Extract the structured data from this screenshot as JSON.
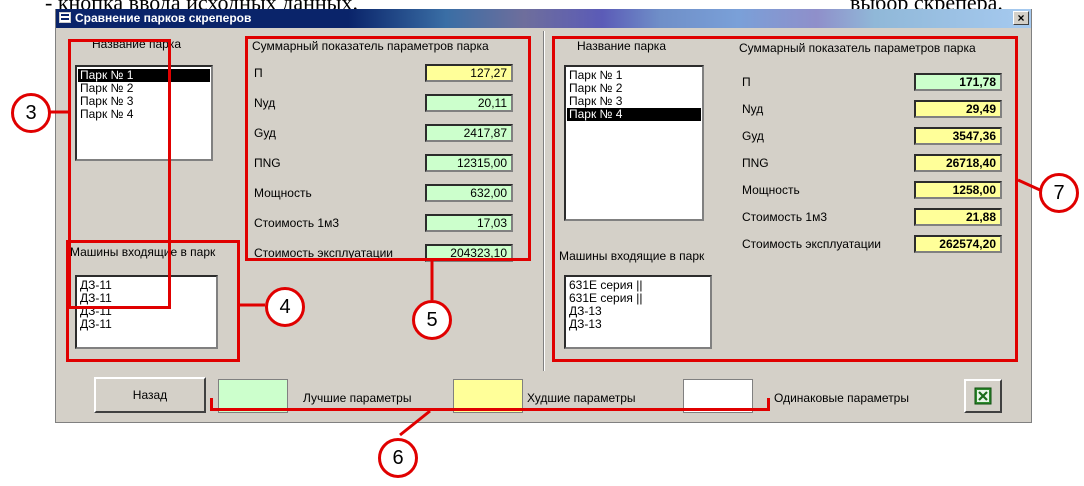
{
  "doc": {
    "top_left_text": "- кнопка ввода исходных данных.",
    "top_right_text": "выбор скрепера."
  },
  "window": {
    "title": "Сравнение парков скреперов",
    "close": "×"
  },
  "left": {
    "park_label": "Название парка",
    "parks": [
      "Парк № 1",
      "Парк № 2",
      "Парк № 3",
      "Парк № 4"
    ],
    "selected_index": 0,
    "machines_label": "Машины входящие в парк",
    "machines": [
      "ДЗ-11",
      "ДЗ-11",
      "ДЗ-11",
      "ДЗ-11"
    ],
    "summary_title": "Суммарный показатель параметров парка",
    "params": [
      {
        "label": "П",
        "value": "127,27",
        "color": "yellow"
      },
      {
        "label": "Nуд",
        "value": "20,11",
        "color": "green"
      },
      {
        "label": "Gуд",
        "value": "2417,87",
        "color": "green"
      },
      {
        "label": "ПNG",
        "value": "12315,00",
        "color": "green"
      },
      {
        "label": "Мощность",
        "value": "632,00",
        "color": "green"
      },
      {
        "label": "Стоимость 1м3",
        "value": "17,03",
        "color": "green"
      },
      {
        "label": "Стоимость эксплуатации",
        "value": "204323,10",
        "color": "green"
      }
    ]
  },
  "right": {
    "park_label": "Название парка",
    "parks": [
      "Парк № 1",
      "Парк № 2",
      "Парк № 3",
      "Парк № 4"
    ],
    "selected_index": 3,
    "machines_label": "Машины входящие в парк",
    "machines": [
      "631Е серия ||",
      "631Е серия ||",
      "ДЗ-13",
      "ДЗ-13"
    ],
    "summary_title": "Суммарный показатель параметров парка",
    "params": [
      {
        "label": "П",
        "value": "171,78",
        "color": "green"
      },
      {
        "label": "Nуд",
        "value": "29,49",
        "color": "yellow"
      },
      {
        "label": "Gуд",
        "value": "3547,36",
        "color": "yellow"
      },
      {
        "label": "ПNG",
        "value": "26718,40",
        "color": "yellow"
      },
      {
        "label": "Мощность",
        "value": "1258,00",
        "color": "yellow"
      },
      {
        "label": "Стоимость 1м3",
        "value": "21,88",
        "color": "yellow"
      },
      {
        "label": "Стоимость эксплуатации",
        "value": "262574,20",
        "color": "yellow"
      }
    ]
  },
  "bottom": {
    "back_label": "Назад",
    "legend_best": "Лучшие параметры",
    "legend_worst": "Худшие параметры",
    "legend_same": "Одинаковые параметры",
    "excel_icon": "excel-icon"
  },
  "callouts": [
    "3",
    "4",
    "5",
    "6",
    "7"
  ],
  "colors": {
    "better": "#ccffcc",
    "worse": "#ffff99",
    "same": "#ffffff",
    "annotation": "#e00000"
  }
}
